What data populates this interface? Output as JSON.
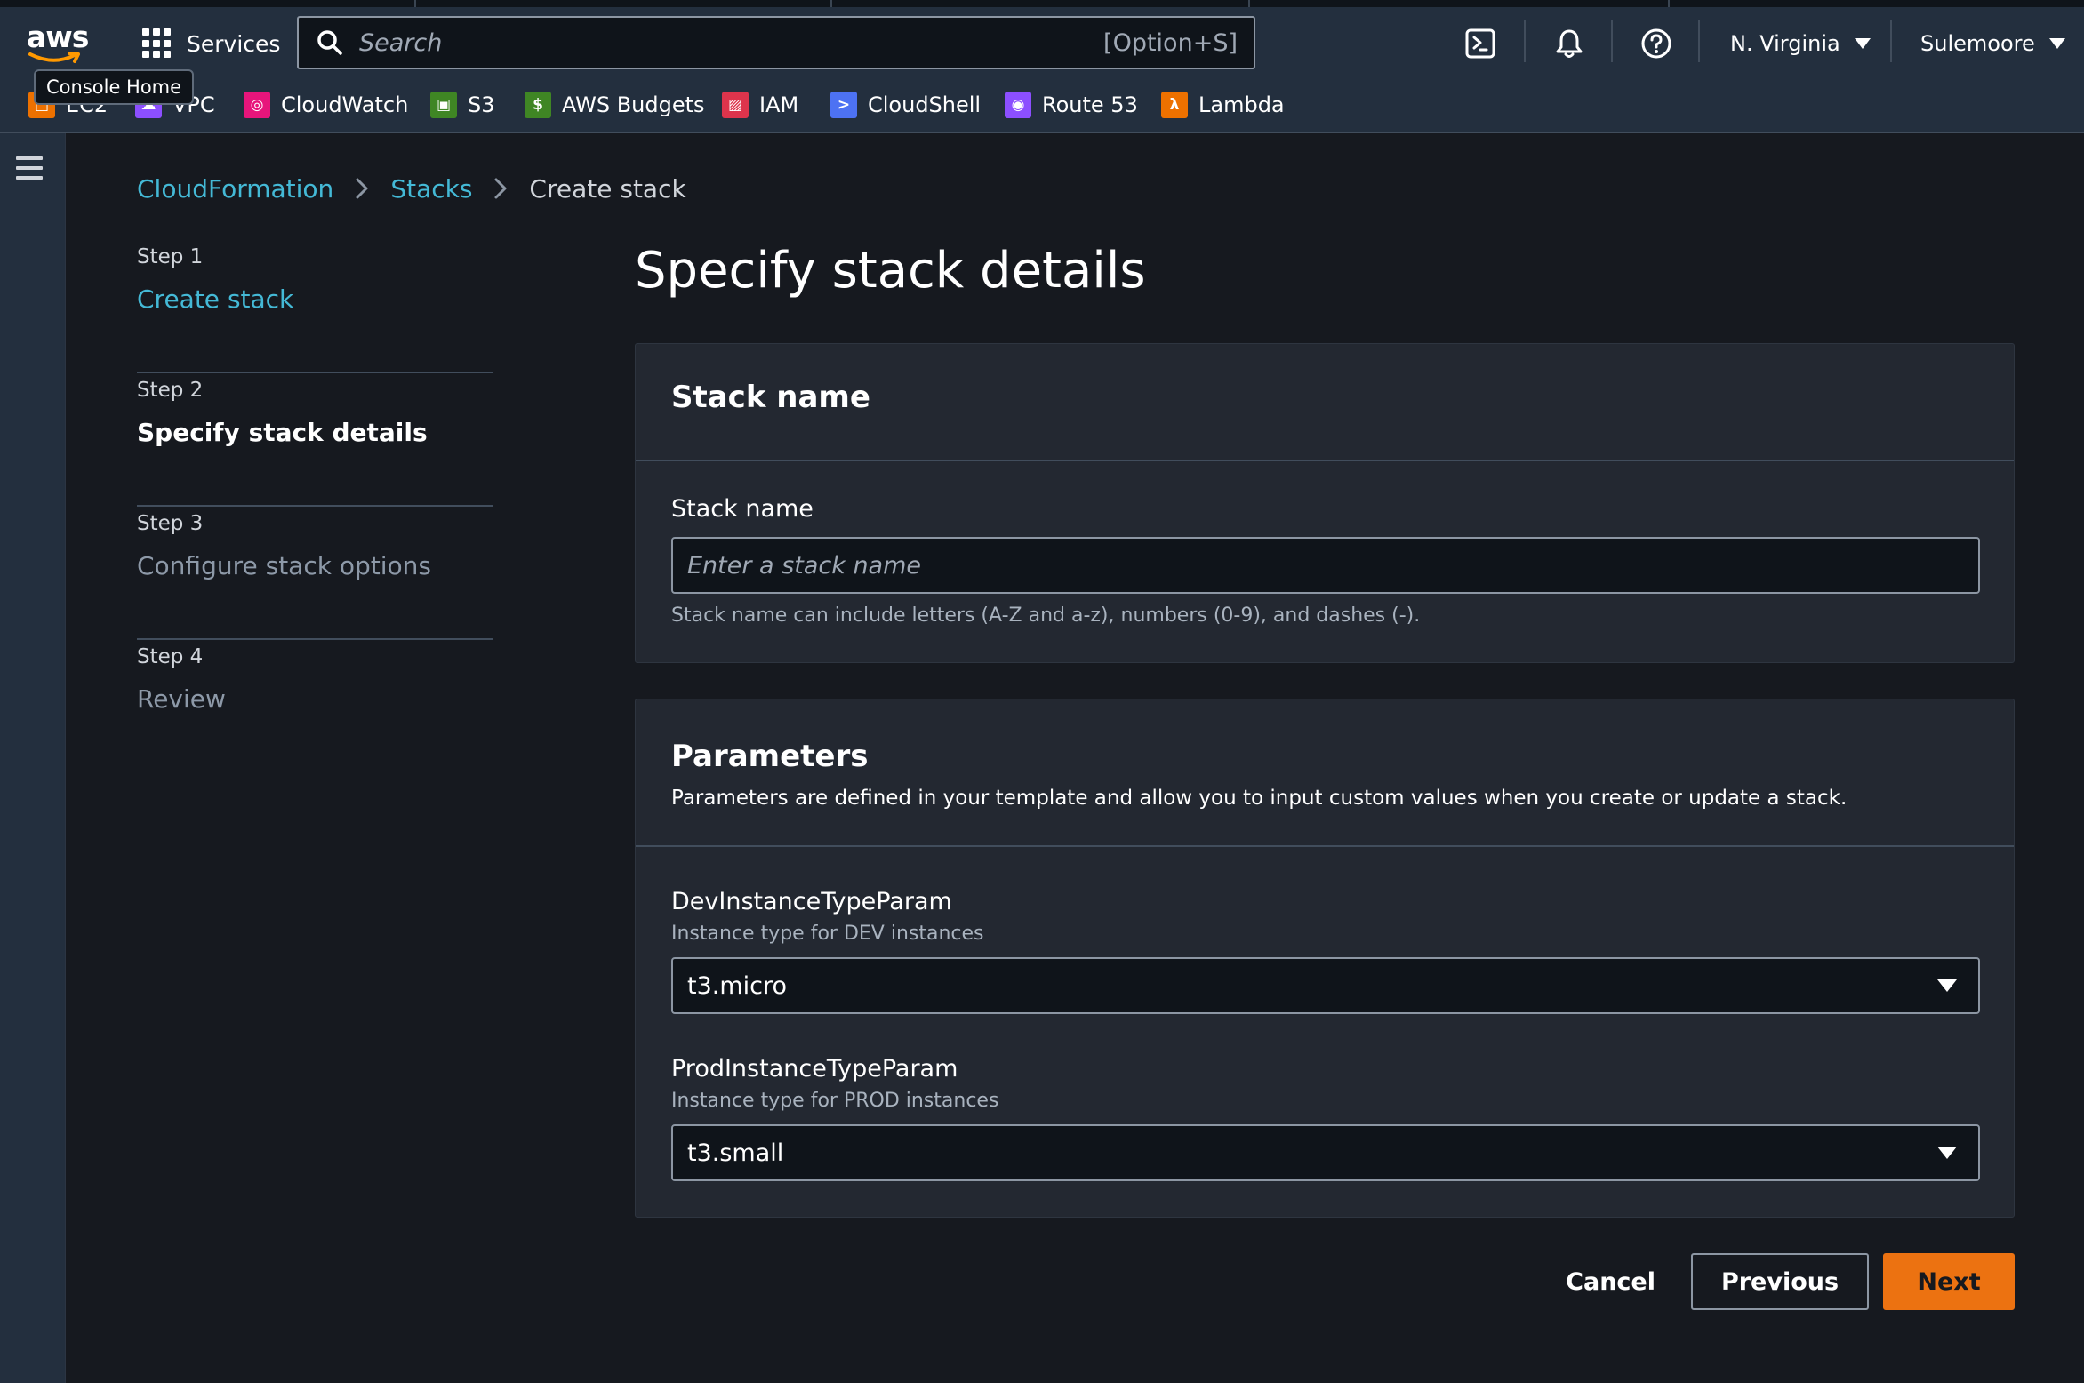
{
  "topnav": {
    "logo_text": "aws",
    "services_label": "Services",
    "search_placeholder": "Search",
    "search_shortcut": "[Option+S]",
    "region": "N. Virginia",
    "user": "Sulemoore",
    "tooltip": "Console Home",
    "favorites": [
      {
        "label": "EC2",
        "color": "#ed7100",
        "icon": "ec2-icon"
      },
      {
        "label": "VPC",
        "color": "#8c4fff",
        "icon": "vpc-icon"
      },
      {
        "label": "CloudWatch",
        "color": "#e7157b",
        "icon": "cloudwatch-icon"
      },
      {
        "label": "S3",
        "color": "#3f8624",
        "icon": "s3-icon"
      },
      {
        "label": "AWS Budgets",
        "color": "#3f8624",
        "icon": "budgets-icon"
      },
      {
        "label": "IAM",
        "color": "#dd344c",
        "icon": "iam-icon"
      },
      {
        "label": "CloudShell",
        "color": "#4d72f3",
        "icon": "cloudshell-icon"
      },
      {
        "label": "Route 53",
        "color": "#8c4fff",
        "icon": "route53-icon"
      },
      {
        "label": "Lambda",
        "color": "#ed7100",
        "icon": "lambda-icon"
      }
    ]
  },
  "breadcrumb": {
    "items": [
      "CloudFormation",
      "Stacks"
    ],
    "current": "Create stack"
  },
  "steps": [
    {
      "number": "Step 1",
      "title": "Create stack",
      "state": "link"
    },
    {
      "number": "Step 2",
      "title": "Specify stack details",
      "state": "active"
    },
    {
      "number": "Step 3",
      "title": "Configure stack options",
      "state": "disabled"
    },
    {
      "number": "Step 4",
      "title": "Review",
      "state": "disabled"
    }
  ],
  "page": {
    "title": "Specify stack details"
  },
  "stack_name_section": {
    "header": "Stack name",
    "label": "Stack name",
    "placeholder": "Enter a stack name",
    "value": "",
    "constraint": "Stack name can include letters (A-Z and a-z), numbers (0-9), and dashes (-)."
  },
  "parameters_section": {
    "header": "Parameters",
    "description": "Parameters are defined in your template and allow you to input custom values when you create or update a stack.",
    "params": [
      {
        "label": "DevInstanceTypeParam",
        "description": "Instance type for DEV instances",
        "value": "t3.micro"
      },
      {
        "label": "ProdInstanceTypeParam",
        "description": "Instance type for PROD instances",
        "value": "t3.small"
      }
    ]
  },
  "actions": {
    "cancel": "Cancel",
    "previous": "Previous",
    "next": "Next"
  },
  "colors": {
    "accent": "#ec7211",
    "link": "#44b9d6",
    "nav_bg": "#232f3e",
    "page_bg": "#16191f",
    "panel_bg": "#232831"
  }
}
